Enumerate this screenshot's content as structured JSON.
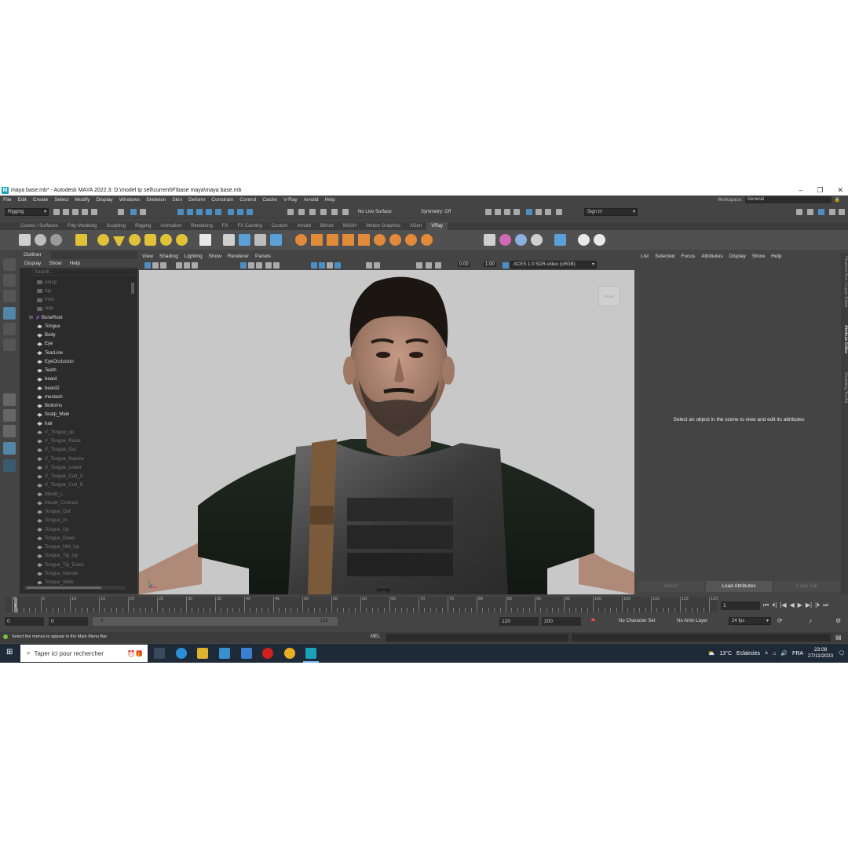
{
  "window": {
    "title": "maya base.mb* - Autodesk MAYA 2022.3: D:\\model tp sell\\current\\F\\base maya\\maya base.mb",
    "logo": "M"
  },
  "menubar": {
    "items": [
      "File",
      "Edit",
      "Create",
      "Select",
      "Modify",
      "Display",
      "Windows",
      "Skeleton",
      "Skin",
      "Deform",
      "Constrain",
      "Control",
      "Cache",
      "V-Ray",
      "Arnold",
      "Help"
    ]
  },
  "workspace": {
    "label": "Workspace:",
    "value": "General"
  },
  "statusline": {
    "menuset": "Rigging",
    "live_surface": "No Live Surface",
    "symmetry": "Symmetry: Off",
    "sign_in": "Sign In"
  },
  "shelf": {
    "tabs": [
      "Curves / Surfaces",
      "Poly Modeling",
      "Sculpting",
      "Rigging",
      "Animation",
      "Rendering",
      "FX",
      "FX Caching",
      "Custom",
      "Arnold",
      "Bifrost",
      "MASH",
      "Motion Graphics",
      "XGen",
      "VRay"
    ],
    "active_tab": "VRay"
  },
  "outliner": {
    "title": "Outliner",
    "menu": [
      "Display",
      "Show",
      "Help"
    ],
    "search_placeholder": "Search...",
    "items": [
      {
        "label": "persp",
        "icon": "camera",
        "dim": true
      },
      {
        "label": "top",
        "icon": "camera",
        "dim": true
      },
      {
        "label": "front",
        "icon": "camera",
        "dim": true
      },
      {
        "label": "side",
        "icon": "camera",
        "dim": true
      },
      {
        "label": "BoneRoot",
        "icon": "joint",
        "dim": false,
        "expandable": true
      },
      {
        "label": "Tongue",
        "icon": "mesh",
        "dim": false
      },
      {
        "label": "Body",
        "icon": "mesh",
        "dim": false
      },
      {
        "label": "Eye",
        "icon": "mesh",
        "dim": false
      },
      {
        "label": "TearLine",
        "icon": "mesh",
        "dim": false
      },
      {
        "label": "EyeOcclusion",
        "icon": "mesh",
        "dim": false
      },
      {
        "label": "Teeth",
        "icon": "mesh",
        "dim": false
      },
      {
        "label": "beard",
        "icon": "mesh",
        "dim": false
      },
      {
        "label": "beard2",
        "icon": "mesh",
        "dim": false
      },
      {
        "label": "mustach",
        "icon": "mesh",
        "dim": false
      },
      {
        "label": "Bottoms",
        "icon": "mesh",
        "dim": false
      },
      {
        "label": "Scalp_Male",
        "icon": "mesh",
        "dim": false
      },
      {
        "label": "hair",
        "icon": "mesh",
        "dim": false
      },
      {
        "label": "V_Tongue_up",
        "icon": "blend",
        "dim": true
      },
      {
        "label": "V_Tongue_Raise",
        "icon": "blend",
        "dim": true
      },
      {
        "label": "V_Tongue_Out",
        "icon": "blend",
        "dim": true
      },
      {
        "label": "V_Tongue_Narrow",
        "icon": "blend",
        "dim": true
      },
      {
        "label": "V_Tongue_Lower",
        "icon": "blend",
        "dim": true
      },
      {
        "label": "V_Tongue_Curl_U",
        "icon": "blend",
        "dim": true
      },
      {
        "label": "V_Tongue_Curl_D",
        "icon": "blend",
        "dim": true
      },
      {
        "label": "Mouth_L",
        "icon": "blend",
        "dim": true
      },
      {
        "label": "Mouth_Contract",
        "icon": "blend",
        "dim": true
      },
      {
        "label": "Tongue_Out",
        "icon": "blend",
        "dim": true
      },
      {
        "label": "Tongue_In",
        "icon": "blend",
        "dim": true
      },
      {
        "label": "Tongue_Up",
        "icon": "blend",
        "dim": true
      },
      {
        "label": "Tongue_Down",
        "icon": "blend",
        "dim": true
      },
      {
        "label": "Tongue_Mid_Up",
        "icon": "blend",
        "dim": true
      },
      {
        "label": "Tongue_Tip_Up",
        "icon": "blend",
        "dim": true
      },
      {
        "label": "Tongue_Tip_Down",
        "icon": "blend",
        "dim": true
      },
      {
        "label": "Tongue_Narrow",
        "icon": "blend",
        "dim": true
      },
      {
        "label": "Tongue_Wide",
        "icon": "blend",
        "dim": true
      }
    ]
  },
  "viewport": {
    "menu": [
      "View",
      "Shading",
      "Lighting",
      "Show",
      "Renderer",
      "Panels"
    ],
    "exposure": "0.00",
    "gamma": "1.00",
    "color_space": "ACES 1.0 SDR-video (sRGB)",
    "camera_label": "persp",
    "viewcube_label": "FRONT"
  },
  "attribute_editor": {
    "menu": [
      "List",
      "Selected",
      "Focus",
      "Attributes",
      "Display",
      "Show",
      "Help"
    ],
    "message": "Select an object in the scene to view and edit its attributes",
    "buttons": [
      "Select",
      "Load Attributes",
      "Copy Tab"
    ],
    "side_tabs": [
      "Channel Box / Layer Editor",
      "Attribute Editor",
      "Modeling Toolkit"
    ]
  },
  "timeline": {
    "ticks": [
      "0",
      "5",
      "10",
      "15",
      "20",
      "25",
      "30",
      "35",
      "40",
      "45",
      "50",
      "55",
      "60",
      "65",
      "70",
      "75",
      "80",
      "85",
      "90",
      "95",
      "100",
      "105",
      "110",
      "115",
      "120"
    ],
    "current_frame": "1",
    "frame_field": "1",
    "playback": [
      "⏮",
      "⏴|",
      "|◀",
      "◀",
      "▶",
      "▶|",
      "|⏵",
      "⏭"
    ]
  },
  "range": {
    "start": "0",
    "anim_start": "0",
    "slider_start": "0",
    "slider_end": "120",
    "end": "120",
    "anim_end": "200",
    "character_set": "No Character Set",
    "anim_layer": "No Anim Layer",
    "fps": "24 fps"
  },
  "commandline": {
    "help": "Select the menus to appear in the Main Menu Bar",
    "mode": "MEL"
  },
  "taskbar": {
    "search": "Taper ici pour rechercher",
    "weather_temp": "13°C",
    "weather_text": "Eclaircies",
    "lang": "FRA",
    "time": "23:08",
    "date": "27/11/2023"
  },
  "colors": {
    "accent": "#5285a6",
    "panel": "#444444",
    "dark": "#2b2b2b",
    "viewport_bg": "#c8c8c8"
  }
}
